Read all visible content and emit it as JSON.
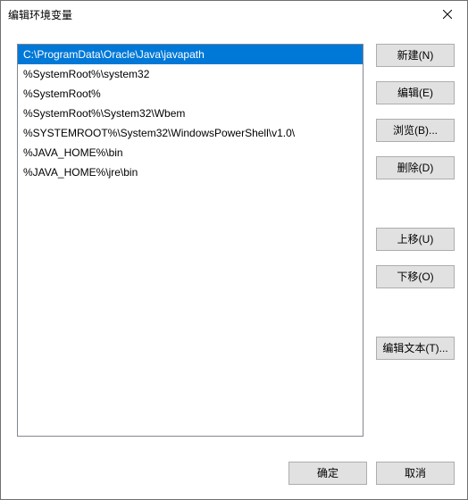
{
  "window": {
    "title": "编辑环境变量"
  },
  "list": {
    "selected_index": 0,
    "items": [
      "C:\\ProgramData\\Oracle\\Java\\javapath",
      "%SystemRoot%\\system32",
      "%SystemRoot%",
      "%SystemRoot%\\System32\\Wbem",
      "%SYSTEMROOT%\\System32\\WindowsPowerShell\\v1.0\\",
      "%JAVA_HOME%\\bin",
      "%JAVA_HOME%\\jre\\bin"
    ]
  },
  "buttons": {
    "new": "新建(N)",
    "edit": "编辑(E)",
    "browse": "浏览(B)...",
    "delete": "删除(D)",
    "move_up": "上移(U)",
    "move_down": "下移(O)",
    "edit_text": "编辑文本(T)...",
    "ok": "确定",
    "cancel": "取消"
  }
}
